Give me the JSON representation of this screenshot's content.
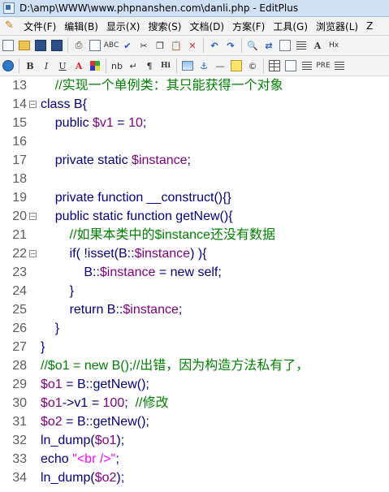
{
  "window": {
    "title": "D:\\amp\\WWW\\www.phpnanshen.com\\danli.php - EditPlus"
  },
  "menu": {
    "items": [
      "文件(F)",
      "编辑(B)",
      "显示(X)",
      "搜索(S)",
      "文档(D)",
      "方案(F)",
      "工具(G)",
      "浏览器(L)",
      "Z"
    ]
  },
  "toolbar1": {
    "icons": [
      "new-file-icon",
      "open-folder-icon",
      "save-icon",
      "save-all-icon",
      "print-icon",
      "print-preview-icon",
      "spellcheck-icon",
      "check-icon",
      "cut-icon",
      "copy-icon",
      "paste-icon",
      "delete-icon",
      "undo-icon",
      "redo-icon",
      "find-icon",
      "find-replace-icon",
      "find-in-files-icon",
      "indent-icon",
      "font-icon",
      "hex-icon"
    ]
  },
  "toolbar2": {
    "icons": [
      "globe-icon",
      "bold-icon",
      "italic-icon",
      "underline-icon",
      "font-color-icon",
      "color-grid-icon",
      "nbsp-icon",
      "line-break-icon",
      "paragraph-icon",
      "heading-icon",
      "image-icon",
      "anchor-icon",
      "hr-icon",
      "highlight-icon",
      "copyright-icon",
      "table-icon",
      "form-icon",
      "list-icon",
      "pre-icon",
      "ordered-list-icon"
    ],
    "labels": {
      "bold": "B",
      "italic": "I",
      "underline": "U",
      "font_color": "A",
      "nbsp": "nb",
      "linebreak": "↵",
      "paragraph": "¶",
      "heading": "Hi",
      "pre": "PRE",
      "hex": "Hx",
      "spell": "ABC"
    }
  },
  "editor": {
    "lines": [
      {
        "num": "13",
        "fold": false,
        "tokens": [
          {
            "t": "    ",
            "c": ""
          },
          {
            "t": "//实现一个单例类：其只能获得一个对象",
            "c": "t-c"
          }
        ]
      },
      {
        "num": "14",
        "fold": true,
        "tokens": [
          {
            "t": "class B{",
            "c": ""
          }
        ]
      },
      {
        "num": "15",
        "fold": false,
        "tokens": [
          {
            "t": "    public ",
            "c": ""
          },
          {
            "t": "$v1",
            "c": "t-v"
          },
          {
            "t": " = ",
            "c": ""
          },
          {
            "t": "10",
            "c": "t-n"
          },
          {
            "t": ";",
            "c": ""
          }
        ]
      },
      {
        "num": "16",
        "fold": false,
        "tokens": []
      },
      {
        "num": "17",
        "fold": false,
        "tokens": [
          {
            "t": "    private static ",
            "c": ""
          },
          {
            "t": "$instance",
            "c": "t-v"
          },
          {
            "t": ";",
            "c": ""
          }
        ]
      },
      {
        "num": "18",
        "fold": false,
        "tokens": []
      },
      {
        "num": "19",
        "fold": false,
        "tokens": [
          {
            "t": "    private function __construct(){}",
            "c": ""
          }
        ]
      },
      {
        "num": "20",
        "fold": true,
        "tokens": [
          {
            "t": "    public static function getNew(){",
            "c": ""
          }
        ]
      },
      {
        "num": "21",
        "fold": false,
        "tokens": [
          {
            "t": "        ",
            "c": ""
          },
          {
            "t": "//如果本类中的$instance还没有数据",
            "c": "t-c"
          }
        ]
      },
      {
        "num": "22",
        "fold": true,
        "tokens": [
          {
            "t": "        if( !isset(B::",
            "c": ""
          },
          {
            "t": "$instance",
            "c": "t-v"
          },
          {
            "t": ") ){",
            "c": ""
          }
        ]
      },
      {
        "num": "23",
        "fold": false,
        "tokens": [
          {
            "t": "            B::",
            "c": ""
          },
          {
            "t": "$instance",
            "c": "t-v"
          },
          {
            "t": " = new self;",
            "c": ""
          }
        ]
      },
      {
        "num": "24",
        "fold": false,
        "tokens": [
          {
            "t": "        }",
            "c": ""
          }
        ]
      },
      {
        "num": "25",
        "fold": false,
        "tokens": [
          {
            "t": "        return B::",
            "c": ""
          },
          {
            "t": "$instance",
            "c": "t-v"
          },
          {
            "t": ";",
            "c": ""
          }
        ]
      },
      {
        "num": "26",
        "fold": false,
        "tokens": [
          {
            "t": "    }",
            "c": ""
          }
        ]
      },
      {
        "num": "27",
        "fold": false,
        "tokens": [
          {
            "t": "}",
            "c": ""
          }
        ]
      },
      {
        "num": "28",
        "fold": false,
        "tokens": [
          {
            "t": "//$o1 = new B();//出错，因为构造方法私有了，",
            "c": "t-c"
          }
        ]
      },
      {
        "num": "29",
        "fold": false,
        "tokens": [
          {
            "t": "$o1",
            "c": "t-v"
          },
          {
            "t": " = B::getNew();",
            "c": ""
          }
        ]
      },
      {
        "num": "30",
        "fold": false,
        "tokens": [
          {
            "t": "$o1",
            "c": "t-v"
          },
          {
            "t": "->v1 = ",
            "c": ""
          },
          {
            "t": "100",
            "c": "t-n"
          },
          {
            "t": ";  ",
            "c": ""
          },
          {
            "t": "//修改",
            "c": "t-c"
          }
        ]
      },
      {
        "num": "31",
        "fold": false,
        "tokens": [
          {
            "t": "$o2",
            "c": "t-v"
          },
          {
            "t": " = B::getNew();",
            "c": ""
          }
        ]
      },
      {
        "num": "32",
        "fold": false,
        "tokens": [
          {
            "t": "ln_dump(",
            "c": ""
          },
          {
            "t": "$o1",
            "c": "t-v"
          },
          {
            "t": ");",
            "c": ""
          }
        ]
      },
      {
        "num": "33",
        "fold": false,
        "tokens": [
          {
            "t": "echo ",
            "c": ""
          },
          {
            "t": "\"<br />\"",
            "c": "t-s"
          },
          {
            "t": ";",
            "c": ""
          }
        ]
      },
      {
        "num": "34",
        "fold": false,
        "tokens": [
          {
            "t": "ln_dump(",
            "c": ""
          },
          {
            "t": "$o2",
            "c": "t-v"
          },
          {
            "t": ");",
            "c": ""
          }
        ]
      }
    ]
  }
}
